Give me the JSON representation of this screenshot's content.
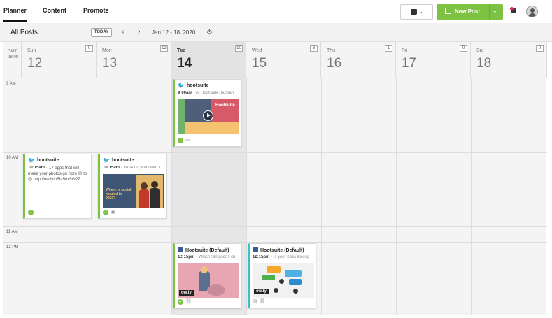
{
  "topbar": {
    "tabs": [
      {
        "label": "Planner",
        "active": true
      },
      {
        "label": "Content",
        "active": false
      },
      {
        "label": "Promote",
        "active": false
      }
    ],
    "owners_icon": "shield-icon",
    "new_post_label": "New Post",
    "notification_icon": "bell-icon",
    "avatar_icon": "user-avatar-icon"
  },
  "toolbar": {
    "view_title": "All Posts",
    "today_label": "TODAY",
    "prev_icon": "chevron-left-icon",
    "next_icon": "chevron-right-icon",
    "date_range": "Jan 12 - 18, 2020",
    "settings_icon": "gear-icon"
  },
  "calendar": {
    "timezone": "GMT\n-08:00",
    "days": [
      {
        "name": "Sun",
        "date": "12",
        "count": "0",
        "today": false
      },
      {
        "name": "Mon",
        "date": "13",
        "count": "12",
        "today": false
      },
      {
        "name": "Tue",
        "date": "14",
        "count": "10",
        "today": true
      },
      {
        "name": "Wed",
        "date": "15",
        "count": "3",
        "today": false
      },
      {
        "name": "Thu",
        "date": "16",
        "count": "1",
        "today": false
      },
      {
        "name": "Fri",
        "date": "17",
        "count": "0",
        "today": false
      },
      {
        "name": "Sat",
        "date": "18",
        "count": "0",
        "today": false
      }
    ],
    "time_labels": [
      "9 AM",
      "10 AM",
      "11 AM",
      "12 PM"
    ]
  },
  "posts": [
    {
      "network": "twitter",
      "account": "hootsuite",
      "time": "9:00am",
      "preview": "At Hootsuite, human",
      "message": "",
      "media_text": "Hootsuite",
      "footer": "video"
    },
    {
      "network": "twitter",
      "account": "hootsuite",
      "time": "10:15am",
      "preview": "",
      "message": "17 apps that will make your photos go from 😐 to 😍 http://ow.ly/h5Ia50x5GPZ",
      "media_text": "",
      "footer": "check"
    },
    {
      "network": "twitter",
      "account": "hootsuite",
      "time": "10:15am",
      "preview": "What do you need t",
      "message": "",
      "media_text": "Where is social headed in 2020?",
      "footer": "image"
    },
    {
      "network": "facebook",
      "account": "Hootsuite (Default)",
      "time": "12:15pm",
      "preview": "Which Simpsons ch",
      "message": "",
      "media_text": "ow.ly",
      "footer": "link"
    },
    {
      "network": "facebook",
      "account": "Hootsuite (Default)",
      "time": "12:15pm",
      "preview": "Is your boss asking",
      "message": "",
      "media_text": "ow.ly",
      "footer": "calendar"
    }
  ],
  "colors": {
    "accent": "#7dc242",
    "today_bg": "#e3e3e3",
    "twitter": "#1da1f2",
    "facebook": "#3b5998"
  }
}
